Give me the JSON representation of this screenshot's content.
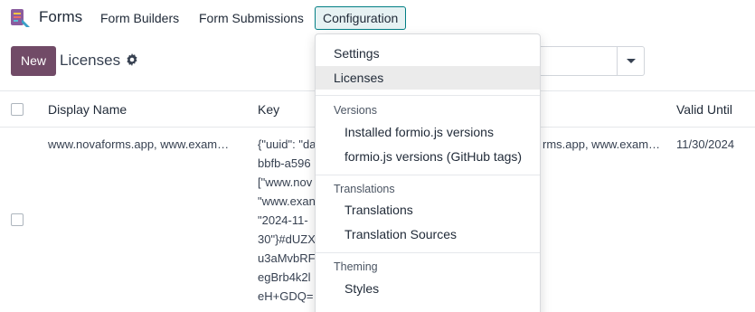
{
  "navbar": {
    "app_name": "Forms",
    "menus": [
      "Form Builders",
      "Form Submissions",
      "Configuration"
    ]
  },
  "control_panel": {
    "new_label": "New",
    "title": "Licenses"
  },
  "list": {
    "columns": {
      "display_name": "Display Name",
      "key": "Key",
      "valid_until": "Valid Until"
    },
    "row": {
      "display_name": "www.novaforms.app, www.exam…",
      "key_lines": [
        "{\"uuid\": \"da",
        "bbfb-a596",
        "[\"www.nov",
        "\"www.exan",
        "\"2024-11-",
        "30\"}#dUZX",
        "u3aMvbRF",
        "egBrb4k2l",
        "eH+GDQ="
      ],
      "domains_tail": "rms.app, www.exam…",
      "valid_until": "11/30/2024"
    }
  },
  "dropdown": {
    "settings": "Settings",
    "licenses": "Licenses",
    "versions_header": "Versions",
    "installed_versions": "Installed formio.js versions",
    "github_versions": "formio.js versions (GitHub tags)",
    "translations_header": "Translations",
    "translations": "Translations",
    "translation_sources": "Translation Sources",
    "theming_header": "Theming",
    "styles": "Styles"
  },
  "colors": {
    "primary": "#714b67",
    "accent": "#017e84"
  }
}
